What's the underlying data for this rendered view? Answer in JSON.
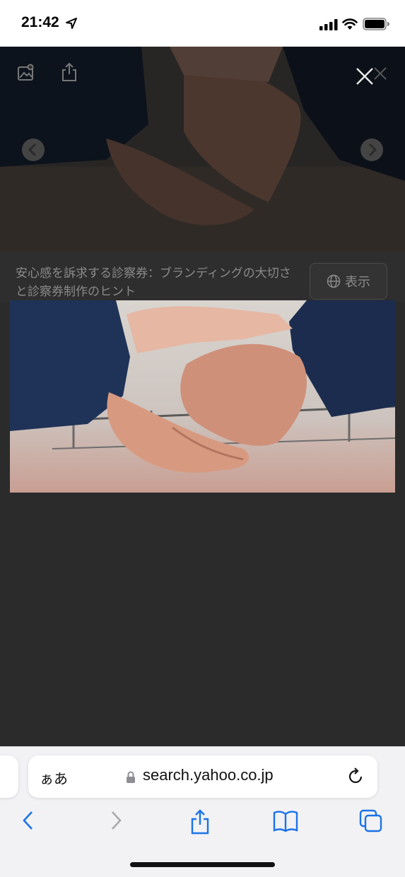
{
  "status_bar": {
    "time": "21:42"
  },
  "viewer": {
    "caption": "安心感を訴求する診察券：ブランディングの大切さと診察券制作のヒント",
    "show_label": "表示"
  },
  "safari": {
    "aa_label": "ぁあ",
    "url": "search.yahoo.co.jp"
  },
  "colors": {
    "accent": "#1a73e8",
    "overlay": "#2b2b2b"
  }
}
